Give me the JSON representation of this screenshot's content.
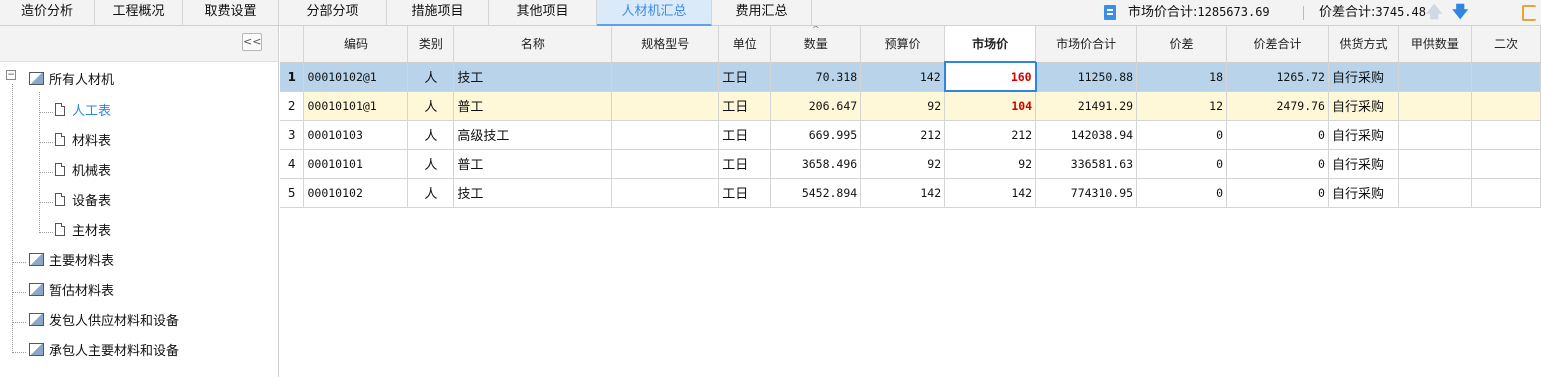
{
  "tabs": [
    {
      "label": "造价分析"
    },
    {
      "label": "工程概况"
    },
    {
      "label": "取费设置"
    },
    {
      "label": "分部分项"
    },
    {
      "label": "措施项目"
    },
    {
      "label": "其他项目"
    },
    {
      "label": "人材机汇总",
      "active": true
    },
    {
      "label": "费用汇总"
    }
  ],
  "summary": {
    "market_total_label": "市场价合计:",
    "market_total_value": "1285673.69",
    "diff_total_label": "价差合计:",
    "diff_total_value": "3745.48"
  },
  "icons": {
    "file": "file-icon",
    "up": "arrow-up-icon",
    "down": "arrow-down-icon",
    "settings": "gear-icon",
    "collapse": "collapse-icon",
    "sort": "sort-up-icon"
  },
  "left_panel": {
    "collapse_label": "<<",
    "root": {
      "label": "所有人材机"
    },
    "children": [
      {
        "label": "人工表",
        "selected": true
      },
      {
        "label": "材料表"
      },
      {
        "label": "机械表"
      },
      {
        "label": "设备表"
      },
      {
        "label": "主材表"
      }
    ],
    "others": [
      {
        "label": "主要材料表"
      },
      {
        "label": "暂估材料表"
      },
      {
        "label": "发包人供应材料和设备"
      },
      {
        "label": "承包人主要材料和设备"
      }
    ]
  },
  "table": {
    "columns": [
      "",
      "编码",
      "类别",
      "名称",
      "规格型号",
      "单位",
      "数量",
      "预算价",
      "市场价",
      "市场价合计",
      "价差",
      "价差合计",
      "供货方式",
      "甲供数量",
      "二次"
    ],
    "rows": [
      {
        "no": "1",
        "code": "00010102@1",
        "type": "人",
        "name": "技工",
        "spec": "",
        "unit": "工日",
        "qty": "70.318",
        "budget": "142",
        "market": "160",
        "market_total": "11250.88",
        "diff": "18",
        "diff_total": "1265.72",
        "supply": "自行采购",
        "owner_qty": "",
        "extra": ""
      },
      {
        "no": "2",
        "code": "00010101@1",
        "type": "人",
        "name": "普工",
        "spec": "",
        "unit": "工日",
        "qty": "206.647",
        "budget": "92",
        "market": "104",
        "market_total": "21491.29",
        "diff": "12",
        "diff_total": "2479.76",
        "supply": "自行采购",
        "owner_qty": "",
        "extra": ""
      },
      {
        "no": "3",
        "code": "00010103",
        "type": "人",
        "name": "高级技工",
        "spec": "",
        "unit": "工日",
        "qty": "669.995",
        "budget": "212",
        "market": "212",
        "market_total": "142038.94",
        "diff": "0",
        "diff_total": "0",
        "supply": "自行采购",
        "owner_qty": "",
        "extra": ""
      },
      {
        "no": "4",
        "code": "00010101",
        "type": "人",
        "name": "普工",
        "spec": "",
        "unit": "工日",
        "qty": "3658.496",
        "budget": "92",
        "market": "92",
        "market_total": "336581.63",
        "diff": "0",
        "diff_total": "0",
        "supply": "自行采购",
        "owner_qty": "",
        "extra": ""
      },
      {
        "no": "5",
        "code": "00010102",
        "type": "人",
        "name": "技工",
        "spec": "",
        "unit": "工日",
        "qty": "5452.894",
        "budget": "142",
        "market": "142",
        "market_total": "774310.95",
        "diff": "0",
        "diff_total": "0",
        "supply": "自行采购",
        "owner_qty": "",
        "extra": ""
      }
    ]
  },
  "colors": {
    "accent": "#2f86e0",
    "selected_row": "#b9d4ea",
    "highlight_row": "#fff8d8",
    "changed_price": "#d40000",
    "active_tab_bg": "#dbeaf8"
  }
}
